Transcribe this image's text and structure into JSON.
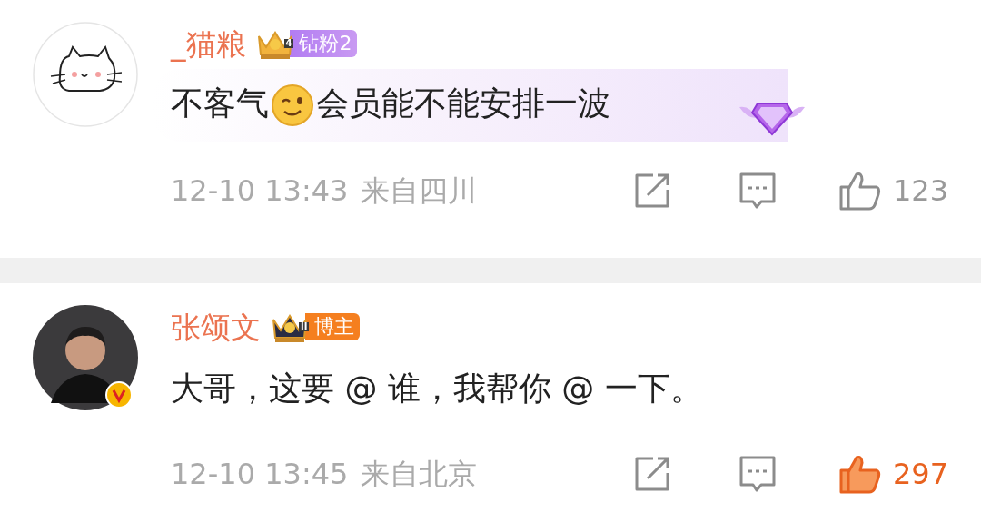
{
  "comments": [
    {
      "name": "_猫粮",
      "avatar": {
        "kind": "cat"
      },
      "verified": false,
      "member_background": true,
      "badge": {
        "kind": "fan",
        "level": "4",
        "label": "钻粉2"
      },
      "content": [
        {
          "kind": "text",
          "text": "不客气"
        },
        {
          "kind": "emoji"
        },
        {
          "kind": "text",
          "text": "会员能不能安排一波"
        }
      ],
      "time": "12-10 13:43",
      "location": "来自四川",
      "likes": "123",
      "liked": false
    },
    {
      "name": "张颂文",
      "avatar": {
        "kind": "person"
      },
      "verified": true,
      "member_background": false,
      "badge": {
        "kind": "blogger",
        "level": "II",
        "label": "博主"
      },
      "content": [
        {
          "kind": "text",
          "text": "大哥，这要 @ 谁，我帮你 @ 一下。"
        }
      ],
      "time": "12-10 13:45",
      "location": "来自北京",
      "likes": "297",
      "liked": true
    }
  ]
}
